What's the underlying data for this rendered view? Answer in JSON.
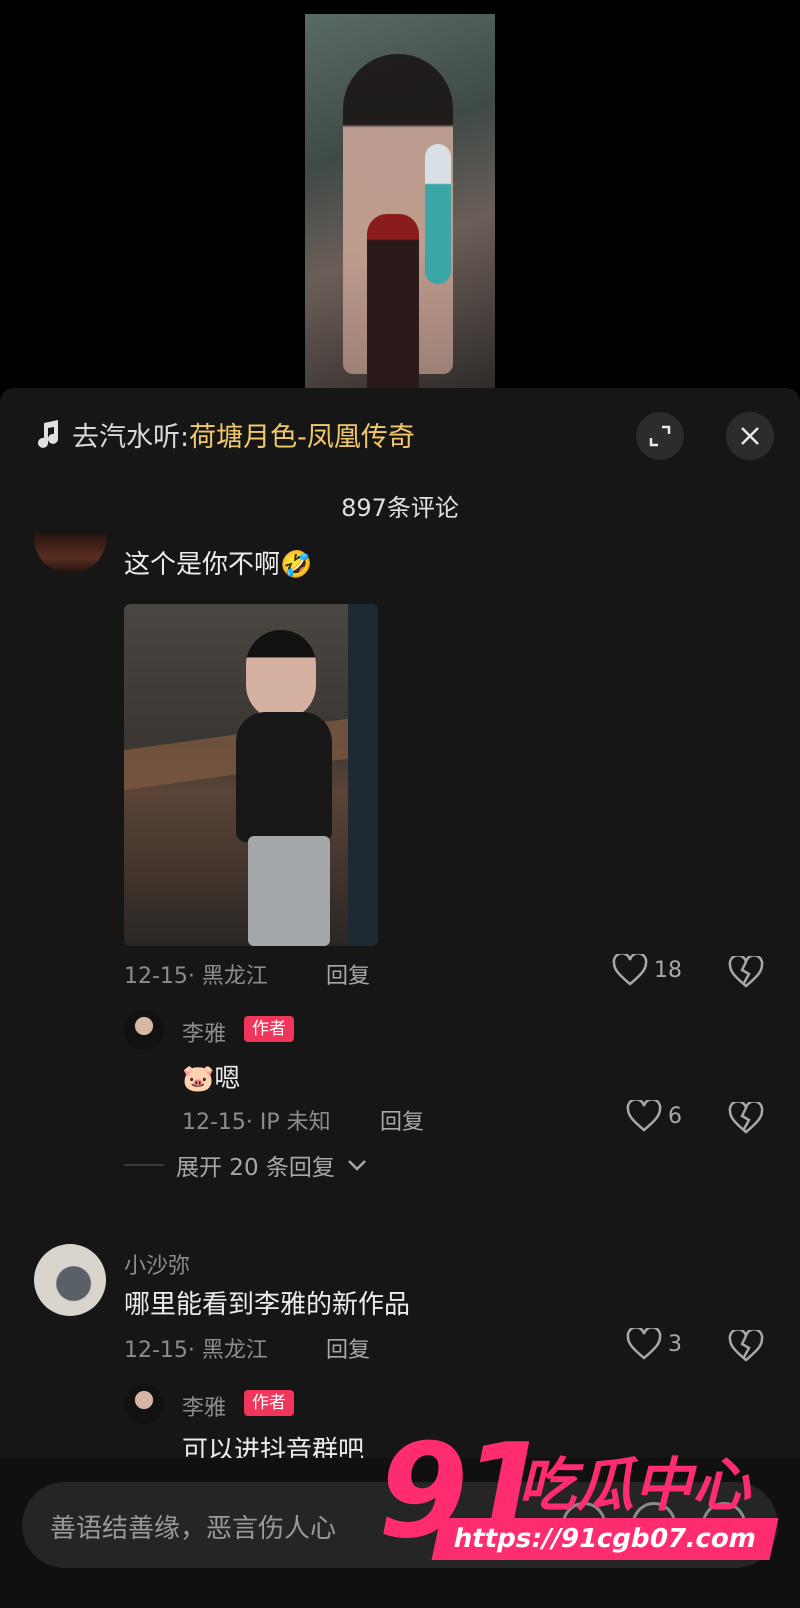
{
  "music": {
    "prefix": "去汽水听:",
    "song": "荷塘月色-凤凰传奇",
    "note_icon": "music-note-icon",
    "expand_icon": "expand-icon",
    "close_icon": "close-icon"
  },
  "comment_count": "897条评论",
  "comments": [
    {
      "text": "这个是你不啊🤣",
      "meta": "12-15· 黑龙江",
      "reply": "回复",
      "likes": "18",
      "image": "photo-attachment",
      "author_reply": {
        "name": "李雅",
        "badge": "作者",
        "text": "🐷嗯",
        "meta": "12-15· IP 未知",
        "reply": "回复",
        "likes": "6"
      },
      "expand": "展开 20 条回复"
    },
    {
      "name": "小沙弥",
      "text": "哪里能看到李雅的新作品",
      "meta": "12-15· 黑龙江",
      "reply": "回复",
      "likes": "3",
      "author_reply": {
        "name": "李雅",
        "badge": "作者",
        "text": "可以进抖音群吧"
      }
    }
  ],
  "input": {
    "placeholder": "善语结善缘，恶言伤人心"
  },
  "watermark": {
    "number": "91",
    "title": "吃瓜中心",
    "url": "https://91cgb07.com"
  },
  "colors": {
    "accent": "#f2c96a",
    "badge": "#f0365a",
    "watermark": "#ff2d6f",
    "sheet": "#161616"
  }
}
